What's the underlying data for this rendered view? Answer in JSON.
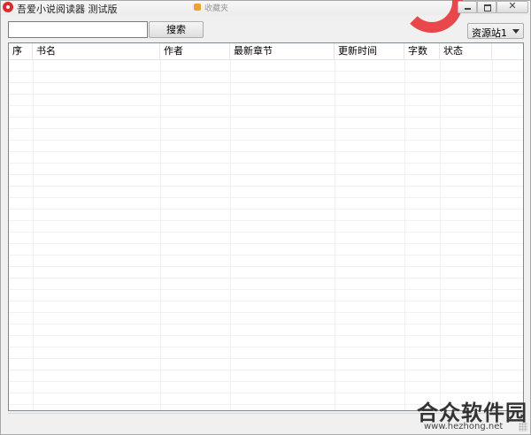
{
  "window": {
    "title": "吾爱小说阅读器 测试版",
    "background_tab": "收藏夹"
  },
  "toolbar": {
    "search_value": "",
    "search_button": "搜索",
    "source_selected": "资源站1"
  },
  "table": {
    "columns": [
      "序",
      "书名",
      "作者",
      "最新章节",
      "更新时间",
      "字数",
      "状态"
    ],
    "rows": []
  },
  "watermark": {
    "text": "合众软件园",
    "url": "www.hezhong.net"
  },
  "colors": {
    "app_icon": "#d92b2b",
    "list_border": "#828790",
    "window_bg": "#f0f0f0"
  }
}
